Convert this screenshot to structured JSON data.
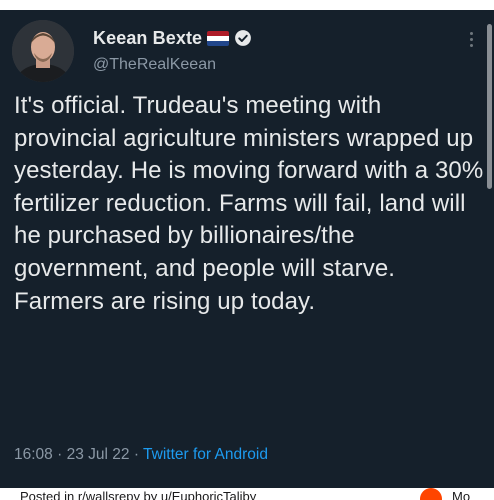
{
  "tweet": {
    "author_name": "Keean Bexte",
    "handle": "@TheRealKeean",
    "text": "It's official. Trudeau's meeting with provincial agriculture ministers wrapped up yesterday. He is moving forward with a 30% fertilizer reduction. Farms will fail, land will he purchased by billionaires/the government, and people will starve. Farmers are rising up today.",
    "time": "16:08",
    "date": "23 Jul 22",
    "separator": "·",
    "source": "Twitter for Android"
  },
  "icons": {
    "flag": "netherlands-flag-icon",
    "verified": "verified-badge-icon",
    "more": "more-vertical-icon"
  },
  "colors": {
    "background": "#15202b",
    "text": "#e7e9ea",
    "muted": "#8b98a5",
    "link": "#1d9bf0"
  },
  "footer": {
    "posted_text": "Posted in r/wallsrepy by u/EuphoricTaliby",
    "tail_text": "Mo"
  }
}
